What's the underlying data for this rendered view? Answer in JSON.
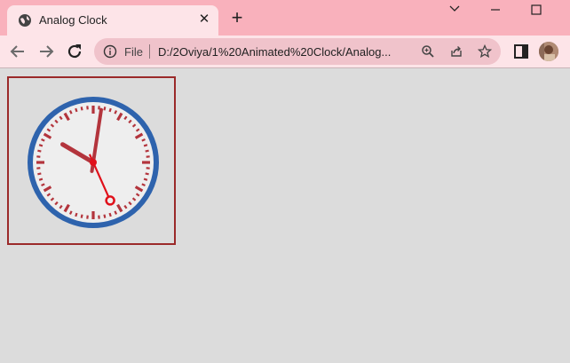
{
  "browser": {
    "tab_title": "Analog Clock",
    "scheme_label": "File",
    "url": "D:/2Oviya/1%20Animated%20Clock/Analog..."
  },
  "icons": {
    "favicon": "globe-icon",
    "tab_close": "close-icon",
    "new_tab": "plus-icon",
    "minimize": "minimize-icon",
    "maximize": "maximize-icon",
    "tab_search": "chevron-down-icon",
    "back": "back-arrow-icon",
    "forward": "forward-arrow-icon",
    "reload": "reload-icon",
    "site_info": "info-icon",
    "zoom": "zoom-icon",
    "share": "share-icon",
    "bookmark": "star-icon",
    "side_panel": "side-panel-icon",
    "profile": "avatar"
  },
  "colors": {
    "tabbar_bg": "#f9b1bc",
    "toolbar_bg": "#fde4e8",
    "page_bg": "#dcdcdc",
    "clock_frame": "#9b2a2a",
    "clock_rim": "#2e63ad",
    "clock_marks": "#b3343c",
    "second_hand": "#e0101a"
  },
  "clock": {
    "hour": 10,
    "minute": 1,
    "second": 26
  }
}
